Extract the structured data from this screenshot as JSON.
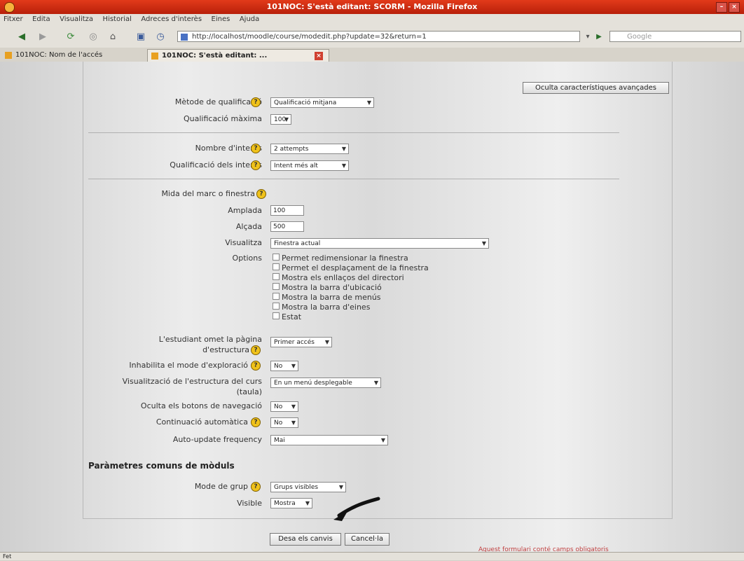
{
  "window": {
    "title": "101NOC: S'està editant: SCORM - Mozilla Firefox"
  },
  "menubar": [
    "Fitxer",
    "Edita",
    "Visualitza",
    "Historial",
    "Adreces d'interès",
    "Eines",
    "Ajuda"
  ],
  "navbar": {
    "url": "http://localhost/moodle/course/modedit.php?update=32&return=1",
    "search_placeholder": "Google"
  },
  "tabs": [
    {
      "label": "101NOC: Nom de l'accés"
    },
    {
      "label": "101NOC: S'està editant: ..."
    }
  ],
  "form": {
    "adv_button": "Oculta característiques avançades",
    "grading_method": {
      "label": "Mètode de qualificació",
      "value": "Qualificació mitjana"
    },
    "max_grade": {
      "label": "Qualificació màxima",
      "value": "100"
    },
    "attempts": {
      "label": "Nombre d'intents",
      "value": "2 attempts"
    },
    "attempt_grading": {
      "label": "Qualificació dels intents",
      "value": "Intent més alt"
    },
    "window_size": {
      "label": "Mida del marc o finestra"
    },
    "width": {
      "label": "Amplada",
      "value": "100"
    },
    "height": {
      "label": "Alçada",
      "value": "500"
    },
    "display": {
      "label": "Visualitza",
      "value": "Finestra actual"
    },
    "options": {
      "label": "Options",
      "items": [
        "Permet redimensionar la finestra",
        "Permet el desplaçament de la finestra",
        "Mostra els enllaços del directori",
        "Mostra la barra d'ubicació",
        "Mostra la barra de menús",
        "Mostra la barra d'eines",
        "Estat"
      ]
    },
    "skip_view": {
      "label1": "L'estudiant omet la pàgina",
      "label2": "d'estructura",
      "value": "Primer accés"
    },
    "disable_browse": {
      "label": "Inhabilita el mode d'exploració",
      "value": "No"
    },
    "course_structure": {
      "label1": "Visualització de l'estructura del curs",
      "label2": "(taula)",
      "value": "En un menú desplegable"
    },
    "hide_nav": {
      "label": "Oculta els botons de navegació",
      "value": "No"
    },
    "auto_continue": {
      "label": "Continuació automàtica",
      "value": "No"
    },
    "auto_update": {
      "label": "Auto-update frequency",
      "value": "Mai"
    },
    "common_section": "Paràmetres comuns de mòduls",
    "group_mode": {
      "label": "Mode de grup",
      "value": "Grups visibles"
    },
    "visible": {
      "label": "Visible",
      "value": "Mostra"
    },
    "save_button": "Desa els canvis",
    "cancel_button": "Cancel·la",
    "footer_note": "Aquest formulari conté camps obligatoris"
  },
  "status": "Fet"
}
